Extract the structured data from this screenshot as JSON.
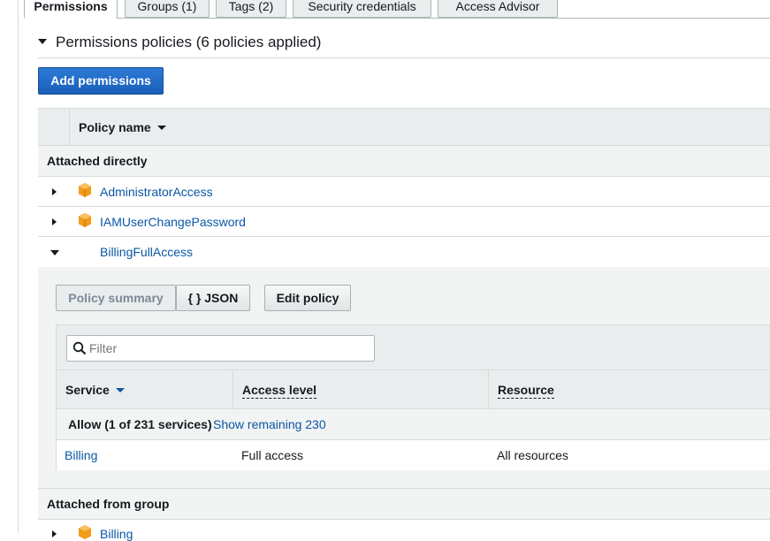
{
  "tabs": [
    {
      "label": "Permissions",
      "active": true
    },
    {
      "label": "Groups (1)",
      "active": false
    },
    {
      "label": "Tags (2)",
      "active": false
    },
    {
      "label": "Security credentials",
      "active": false
    },
    {
      "label": "Access Advisor",
      "active": false
    }
  ],
  "section": {
    "title": "Permissions policies (6 policies applied)",
    "add_button": "Add permissions"
  },
  "policy_table": {
    "column_header": "Policy name",
    "group_direct": "Attached directly",
    "group_from_group": "Attached from group",
    "policies": [
      {
        "name": "AdministratorAccess",
        "expanded": false,
        "icon": "aws-managed-policy-icon"
      },
      {
        "name": "IAMUserChangePassword",
        "expanded": false,
        "icon": "aws-managed-policy-icon"
      },
      {
        "name": "BillingFullAccess",
        "expanded": true,
        "icon": ""
      }
    ],
    "group_policy": {
      "name": "Billing",
      "icon": "aws-managed-policy-icon"
    }
  },
  "detail": {
    "tab_summary": "Policy summary",
    "tab_json": "{ } JSON",
    "edit_button": "Edit policy",
    "filter_placeholder": "Filter",
    "columns": [
      "Service",
      "Access level",
      "Resource"
    ],
    "allow_text": "Allow (1 of 231 services)",
    "show_remaining": "Show remaining 230",
    "rows": [
      {
        "service": "Billing",
        "access": "Full access",
        "resource": "All resources"
      }
    ]
  },
  "colors": {
    "link": "#0a57a6",
    "primary_button": "#1a5fb8",
    "policy_icon": "#f39c1b"
  }
}
